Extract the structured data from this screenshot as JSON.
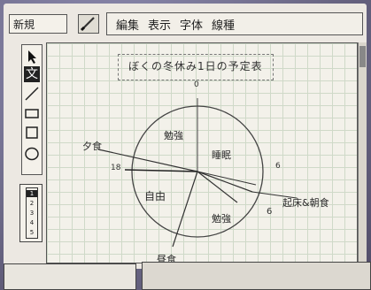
{
  "window": {
    "filename": "新規"
  },
  "menu": [
    {
      "label": "編集"
    },
    {
      "label": "表示"
    },
    {
      "label": "字体"
    },
    {
      "label": "線種"
    }
  ],
  "tools": {
    "text_tool_glyph": "文",
    "pointer_icon": "arrow-pointer-icon",
    "line_icon": "line-tool-icon",
    "rect_icon": "rectangle-tool-icon",
    "square_icon": "square-tool-icon",
    "ellipse_icon": "ellipse-tool-icon"
  },
  "page_widget": {
    "pages": [
      "1",
      "2",
      "3",
      "4",
      "5"
    ]
  },
  "document": {
    "title": "ぼくの冬休み1日の予定表"
  },
  "clock_chart": {
    "tick_labels": {
      "top": "0",
      "right": "6",
      "left": "18",
      "bottom_right": "6"
    },
    "segments": [
      {
        "label": "勉強"
      },
      {
        "label": "睡眠"
      },
      {
        "label": "自由"
      },
      {
        "label": "勉強"
      }
    ],
    "annotations": [
      {
        "label": "夕食"
      },
      {
        "label": "起床&朝食"
      },
      {
        "label": "昼食"
      }
    ]
  }
}
